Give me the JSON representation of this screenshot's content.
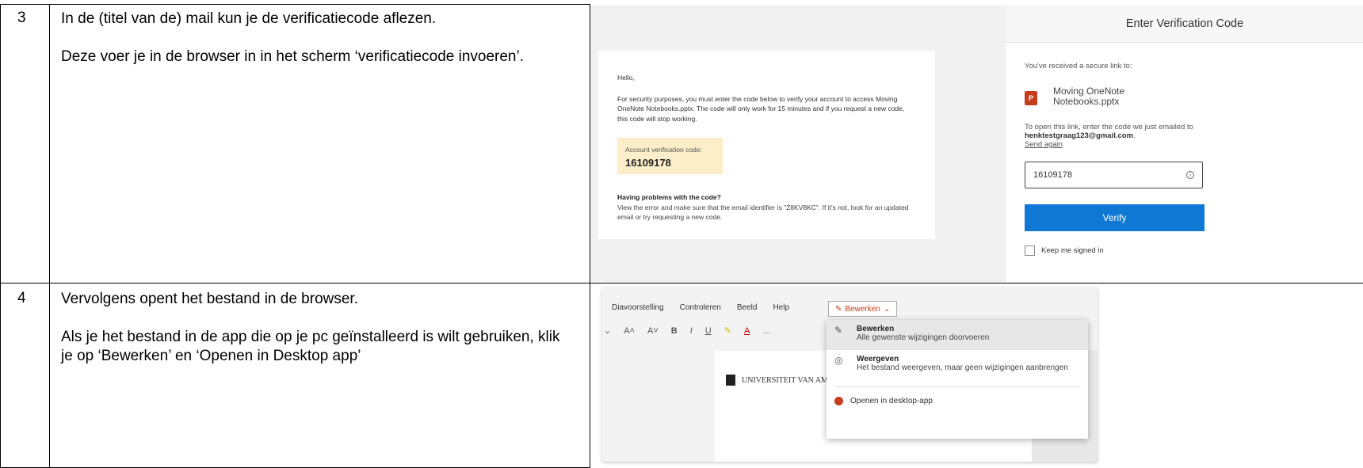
{
  "rows": [
    {
      "number": "3",
      "paragraphs": [
        "In de (titel van de) mail kun je de verificatiecode aflezen.",
        "Deze voer je in de browser in in het scherm ‘verificatiecode invoeren’."
      ]
    },
    {
      "number": "4",
      "paragraphs": [
        "Vervolgens opent het bestand in de browser.",
        "Als je het bestand in de app die op je pc geïnstalleerd is wilt gebruiken, klik je op ‘Bewerken’ en ‘Openen in Desktop app’"
      ]
    }
  ],
  "email": {
    "greeting": "Hello,",
    "body": "For security purposes, you must enter the code below to verify your account to access Moving OneNote Notebooks.pptx. The code will only work for 15 minutes and if you request a new code, this code will stop working.",
    "code_label": "Account verification code:",
    "code_value": "16109178",
    "problem_title": "Having problems with the code?",
    "problem_text": "View the error and make sure that the email identifier is \"Z8KV8KC\". If it's not, look for an updated email or try requesting a new code."
  },
  "verify": {
    "title": "Enter Verification Code",
    "received": "You've received a secure link to:",
    "file_name": "Moving OneNote Notebooks.pptx",
    "open_prefix": "To open this link, enter the code we just emailed to ",
    "email": "henktestgraag123@gmail.com",
    "open_suffix": ".",
    "send_again": "Send again",
    "input_value": "16109178",
    "button": "Verify",
    "keep_signed": "Keep me signed in",
    "accent": "#0f78d4"
  },
  "ribbon": {
    "tabs": [
      "Diavoorstelling",
      "Controleren",
      "Beeld",
      "Help"
    ],
    "edit_tab": "Bewerken",
    "toolbar": [
      "A˄",
      "A˅",
      "B",
      "I",
      "U",
      "…"
    ],
    "logo_text": "UNIVERSITEIT VAN AMST",
    "menu": [
      {
        "title": "Bewerken",
        "desc": "Alle gewenste wijzigingen doorvoeren",
        "icon": "pencil-icon"
      },
      {
        "title": "Weergeven",
        "desc": "Het bestand weergeven, maar geen wijzigingen aanbrengen",
        "icon": "glasses-icon"
      }
    ],
    "open_desktop": "Openen in desktop-app",
    "brand": "#c43e1c"
  }
}
